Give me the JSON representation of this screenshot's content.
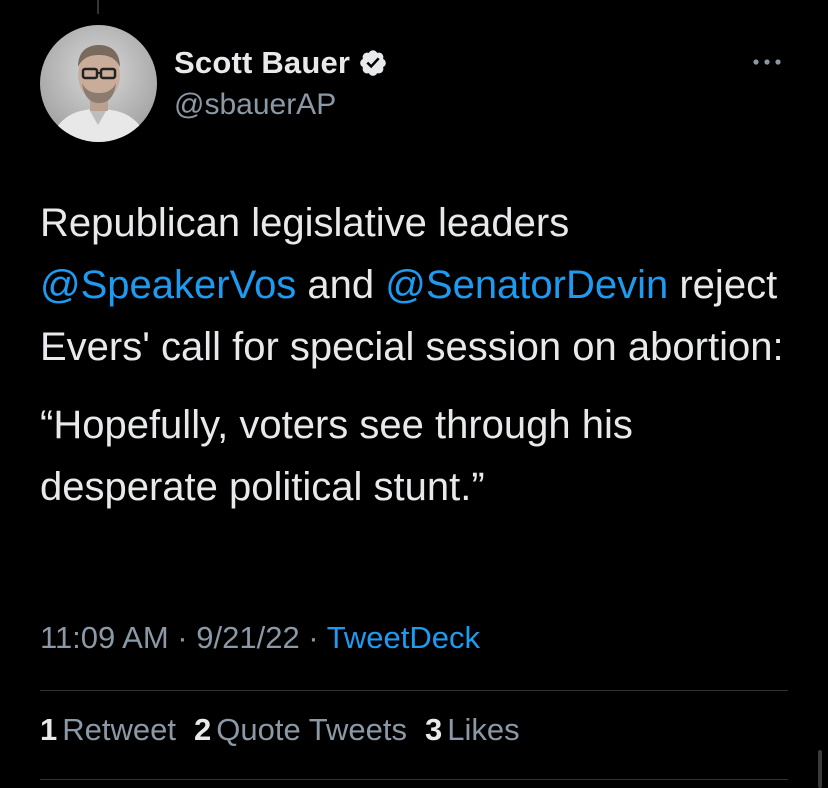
{
  "author": {
    "display_name": "Scott Bauer",
    "handle": "@sbauerAP",
    "verified": true
  },
  "tweet": {
    "paragraph1": {
      "part1": "Republican legislative leaders ",
      "mention1": "@SpeakerVos",
      "part2": " and ",
      "mention2": "@SenatorDevin",
      "part3": " reject Evers' call for special session on abortion:"
    },
    "paragraph2": "“Hopefully, voters see through his desperate political stunt.”"
  },
  "meta": {
    "time": "11:09 AM",
    "separator1": " · ",
    "date": "9/21/22",
    "separator2": " · ",
    "source": "TweetDeck"
  },
  "stats": {
    "retweets": {
      "count": "1",
      "label": "Retweet"
    },
    "quotes": {
      "count": "2",
      "label": "Quote Tweets"
    },
    "likes": {
      "count": "3",
      "label": "Likes"
    }
  },
  "colors": {
    "background": "#000000",
    "text": "#e7e9ea",
    "secondary": "#8b98a5",
    "link": "#1d9bf0",
    "divider": "#2f3336"
  },
  "icons": {
    "verified": "verified-badge-icon",
    "more": "more-horizontal-icon"
  }
}
